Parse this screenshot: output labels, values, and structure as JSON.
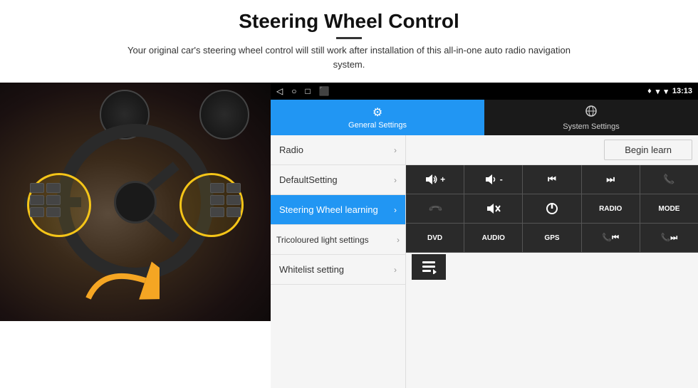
{
  "page": {
    "title": "Steering Wheel Control",
    "divider": true,
    "subtitle": "Your original car's steering wheel control will still work after installation of this all-in-one auto radio navigation system."
  },
  "android": {
    "status_bar": {
      "back_icon": "◁",
      "home_icon": "○",
      "recents_icon": "□",
      "screenshot_icon": "⬛",
      "location_icon": "♦",
      "wifi_icon": "▾",
      "signal_icon": "▾",
      "time": "13:13"
    },
    "tabs": [
      {
        "label": "General Settings",
        "icon": "⚙",
        "active": true
      },
      {
        "label": "System Settings",
        "icon": "🌐",
        "active": false
      }
    ],
    "menu": {
      "items": [
        {
          "label": "Radio",
          "active": false
        },
        {
          "label": "DefaultSetting",
          "active": false
        },
        {
          "label": "Steering Wheel learning",
          "active": true
        },
        {
          "label": "Tricoloured light settings",
          "active": false
        },
        {
          "label": "Whitelist setting",
          "active": false
        }
      ]
    },
    "controls": {
      "begin_learn": "Begin learn",
      "row1": [
        "🔊+",
        "🔊-",
        "⏮",
        "⏭",
        "📞"
      ],
      "row2": [
        "📞",
        "🔇",
        "⏻",
        "RADIO",
        "MODE"
      ],
      "row3_labels": [
        "DVD",
        "AUDIO",
        "GPS",
        "📞⏮",
        "📞⏭"
      ],
      "row4_icon": "🗓"
    }
  }
}
